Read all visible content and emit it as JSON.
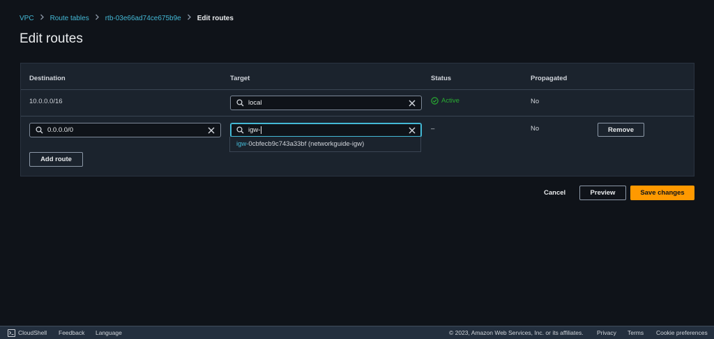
{
  "breadcrumb": {
    "items": [
      "VPC",
      "Route tables",
      "rtb-03e66ad74ce675b9e"
    ],
    "current": "Edit routes"
  },
  "page": {
    "title": "Edit routes"
  },
  "table": {
    "headers": {
      "destination": "Destination",
      "target": "Target",
      "status": "Status",
      "propagated": "Propagated"
    },
    "row1": {
      "destination": "10.0.0.0/16",
      "target": "local",
      "status": "Active",
      "propagated": "No"
    },
    "row2": {
      "destination": "0.0.0.0/0",
      "target": "igw-",
      "status": "–",
      "propagated": "No",
      "remove_label": "Remove"
    },
    "suggestion": {
      "match": "igw-",
      "rest": "0cbfecb9c743a33bf (networkguide-igw)"
    },
    "add_route_label": "Add route"
  },
  "actions": {
    "cancel": "Cancel",
    "preview": "Preview",
    "save": "Save changes"
  },
  "footer": {
    "cloudshell": "CloudShell",
    "feedback": "Feedback",
    "language": "Language",
    "copyright": "© 2023, Amazon Web Services, Inc. or its affiliates.",
    "privacy": "Privacy",
    "terms": "Terms",
    "cookie": "Cookie preferences"
  },
  "colors": {
    "accent": "#44b9d6",
    "primary": "#ff9900",
    "success": "#29ad32"
  }
}
